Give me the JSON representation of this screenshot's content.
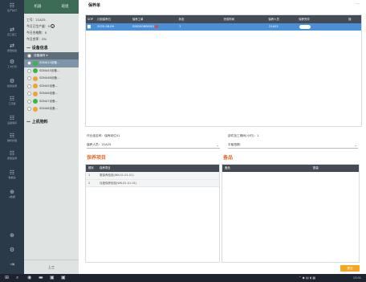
{
  "rail": {
    "items": [
      {
        "icon": "☷",
        "label": "生产执行",
        "icon_name": "grid-icon"
      },
      {
        "icon": "⇄",
        "label": "员工报工",
        "icon_name": "swap-icon"
      },
      {
        "icon": "⇄",
        "label": "质量检验",
        "icon_name": "swap-icon"
      },
      {
        "icon": "⚙",
        "label": "工卡打印",
        "icon_name": "gear-icon"
      },
      {
        "icon": "⚙",
        "label": "检验追溯",
        "icon_name": "gear-icon"
      },
      {
        "icon": "☷",
        "label": "工序报",
        "icon_name": "grid-icon"
      },
      {
        "icon": "☷",
        "label": "设备保养",
        "icon_name": "grid-icon"
      },
      {
        "icon": "☷",
        "label": "物料管理",
        "icon_name": "grid-icon"
      },
      {
        "icon": "☷",
        "label": "质量追溯",
        "icon_name": "grid-icon"
      },
      {
        "icon": "☷",
        "label": "数据采",
        "icon_name": "grid-icon"
      },
      {
        "icon": "⊕",
        "label": "a数据",
        "icon_name": "plus-circle-icon"
      },
      {
        "icon": "⊕",
        "label": "",
        "icon_name": "plus-circle-icon"
      },
      {
        "icon": "⚙",
        "label": "",
        "icon_name": "settings-icon"
      },
      {
        "icon": "⇥",
        "label": "",
        "icon_name": "logout-icon"
      }
    ]
  },
  "panel": {
    "tabs": [
      "机器",
      "班组"
    ],
    "employee_line": "工号：21A25",
    "produce_line": "今日已生产量：0",
    "qualified_line": "今日合格数：0",
    "rate_line": "今日良率：0%",
    "device_section": "设备信息",
    "device_header": "设备编号 ▾",
    "devices": [
      {
        "name": "SDNA13设备...",
        "status": "green",
        "selected": true
      },
      {
        "name": "SDNA43设备...",
        "status": "green",
        "selected": false
      },
      {
        "name": "SDNA4B设备...",
        "status": "orange",
        "selected": false
      },
      {
        "name": "SDNA5设备...",
        "status": "orange",
        "selected": false
      },
      {
        "name": "SDNA6设备...",
        "status": "orange",
        "selected": false
      },
      {
        "name": "SDNA7设备...",
        "status": "green",
        "selected": false
      },
      {
        "name": "SDNA8设备...",
        "status": "orange",
        "selected": false
      }
    ],
    "material_section": "上机物料",
    "bottom_button": "上工"
  },
  "main": {
    "title": "保养单",
    "close": "...",
    "table": {
      "headers": [
        "SOP",
        "计划保养日",
        "保养工单",
        "状态",
        "完成时间",
        "保养人员",
        "保养完毕",
        "操"
      ],
      "rows": [
        {
          "sop": "▆",
          "date": "2025-08-09",
          "order": "SS8250808001",
          "status": "1",
          "done_time": "",
          "staff": "21A25",
          "toggle": ""
        }
      ]
    },
    "owner_line": "作业组名称：保养岗位01",
    "period_line": "部件加工期间(小时)：1",
    "staff_label": "保养人员：",
    "staff_value": "21A25",
    "photo_label": "平板拍照：",
    "items_title": "保养项目",
    "parts_title": "备品",
    "items_table": {
      "headers": [
        "顺序",
        "保养项目"
      ],
      "rows": [
        {
          "seq": "1",
          "name": "周保养检验(WK-01-01-01)"
        },
        {
          "seq": "2",
          "name": "月度保养检验(WK-02-01-01)"
        }
      ]
    },
    "parts_table": {
      "headers": [
        "备品",
        "数量"
      ]
    },
    "submit": "提交"
  },
  "taskbar": {
    "time": "13:01"
  },
  "colors": {
    "rail": "#2b3a48",
    "panel_header": "#3c6b56",
    "table_header": "#444b55",
    "row_selected": "#4a90d9",
    "accent": "#e86a2c",
    "submit": "#f5a623"
  }
}
